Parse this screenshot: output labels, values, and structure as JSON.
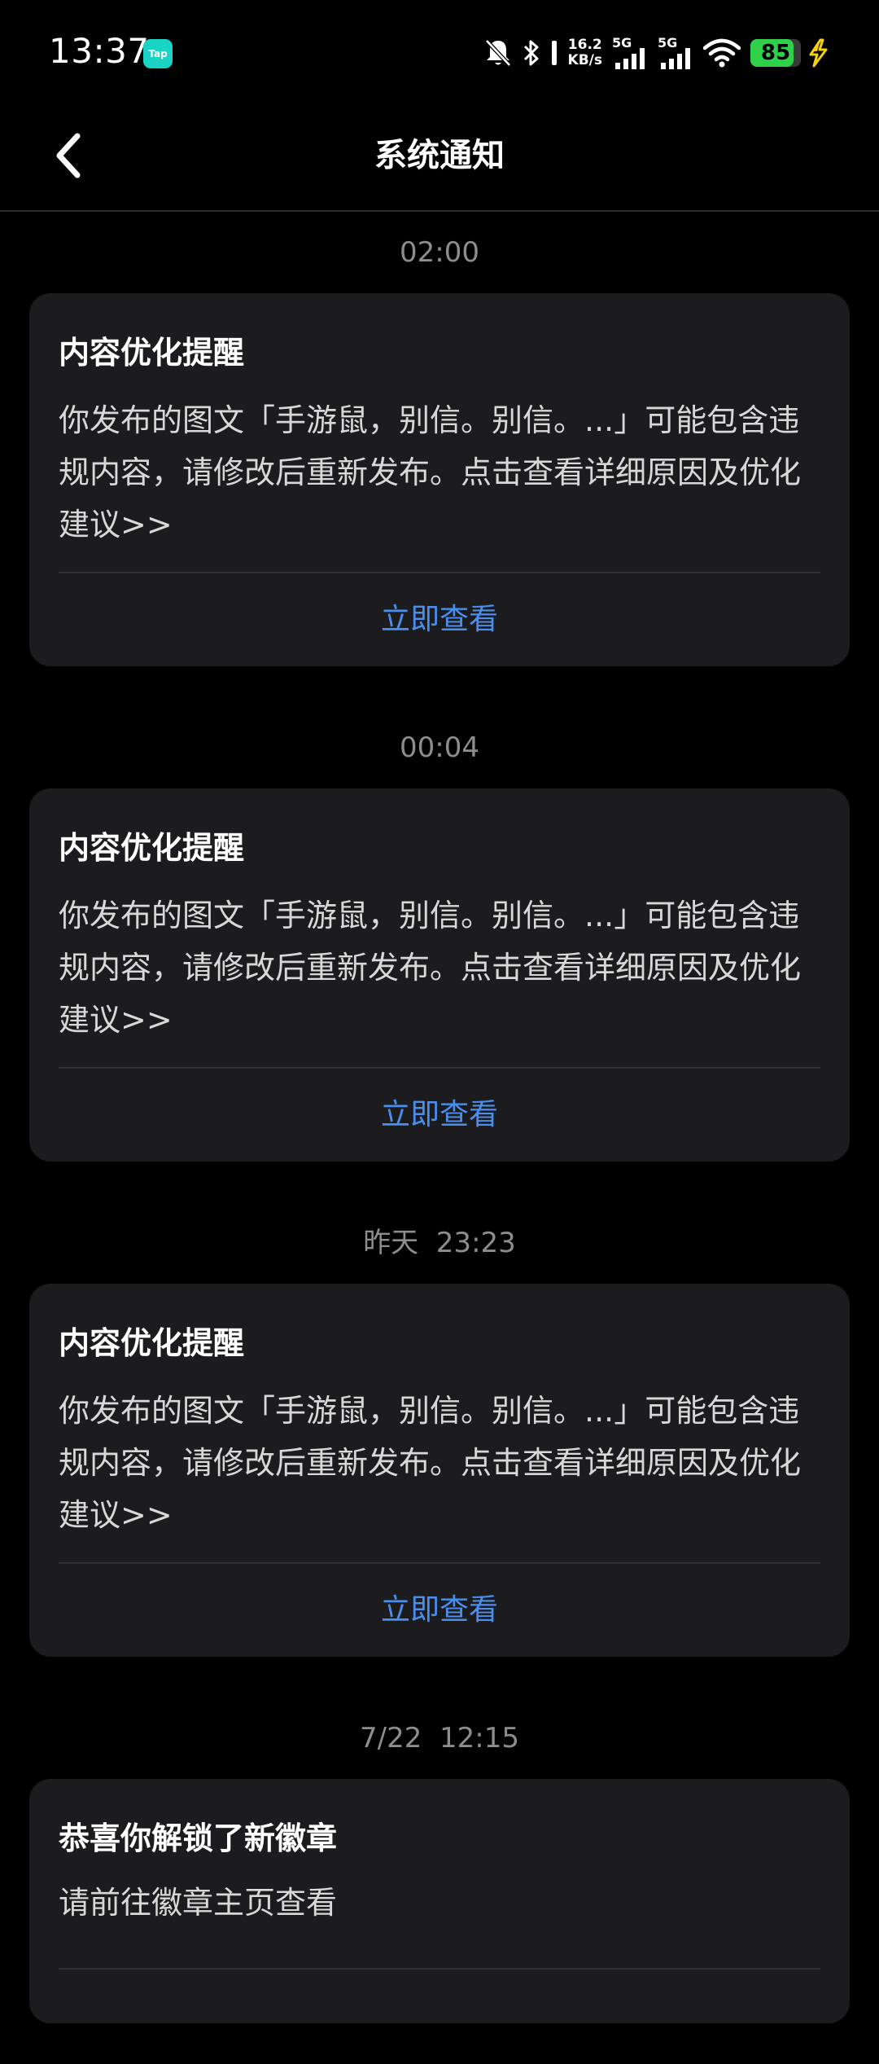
{
  "status_bar": {
    "time": "13:37",
    "app_badge": "Tap",
    "net_speed_value": "16.2",
    "net_speed_unit": "KB/s",
    "sim1_label": "5G",
    "sim2_label": "5G",
    "battery_level": "85",
    "battery_fraction": 0.85,
    "battery_color": "#2fd14a",
    "charging_color": "#f5d20a",
    "icons": [
      "bell-off-icon",
      "bluetooth-icon",
      "signal-icon",
      "signal-icon",
      "wifi-icon",
      "battery-icon",
      "charging-icon"
    ]
  },
  "header": {
    "title": "系统通知",
    "back_icon": "chevron-left-icon"
  },
  "notifications": [
    {
      "time": "02:00",
      "title": "内容优化提醒",
      "body": "你发布的图文「手游鼠，别信。别信。...」可能包含违规内容，请修改后重新发布。点击查看详细原因及优化建议>>",
      "action": "立即查看"
    },
    {
      "time": "00:04",
      "title": "内容优化提醒",
      "body": "你发布的图文「手游鼠，别信。别信。...」可能包含违规内容，请修改后重新发布。点击查看详细原因及优化建议>>",
      "action": "立即查看"
    },
    {
      "time": "昨天  23:23",
      "title": "内容优化提醒",
      "body": "你发布的图文「手游鼠，别信。别信。...」可能包含违规内容，请修改后重新发布。点击查看详细原因及优化建议>>",
      "action": "立即查看"
    },
    {
      "time": "7/22  12:15",
      "title": "恭喜你解锁了新徽章",
      "body": "请前往徽章主页查看",
      "action": ""
    }
  ],
  "colors": {
    "background": "#000000",
    "card": "#1c1c1e",
    "action_link": "#4a8ff0",
    "timestamp": "#8d8d8d"
  }
}
